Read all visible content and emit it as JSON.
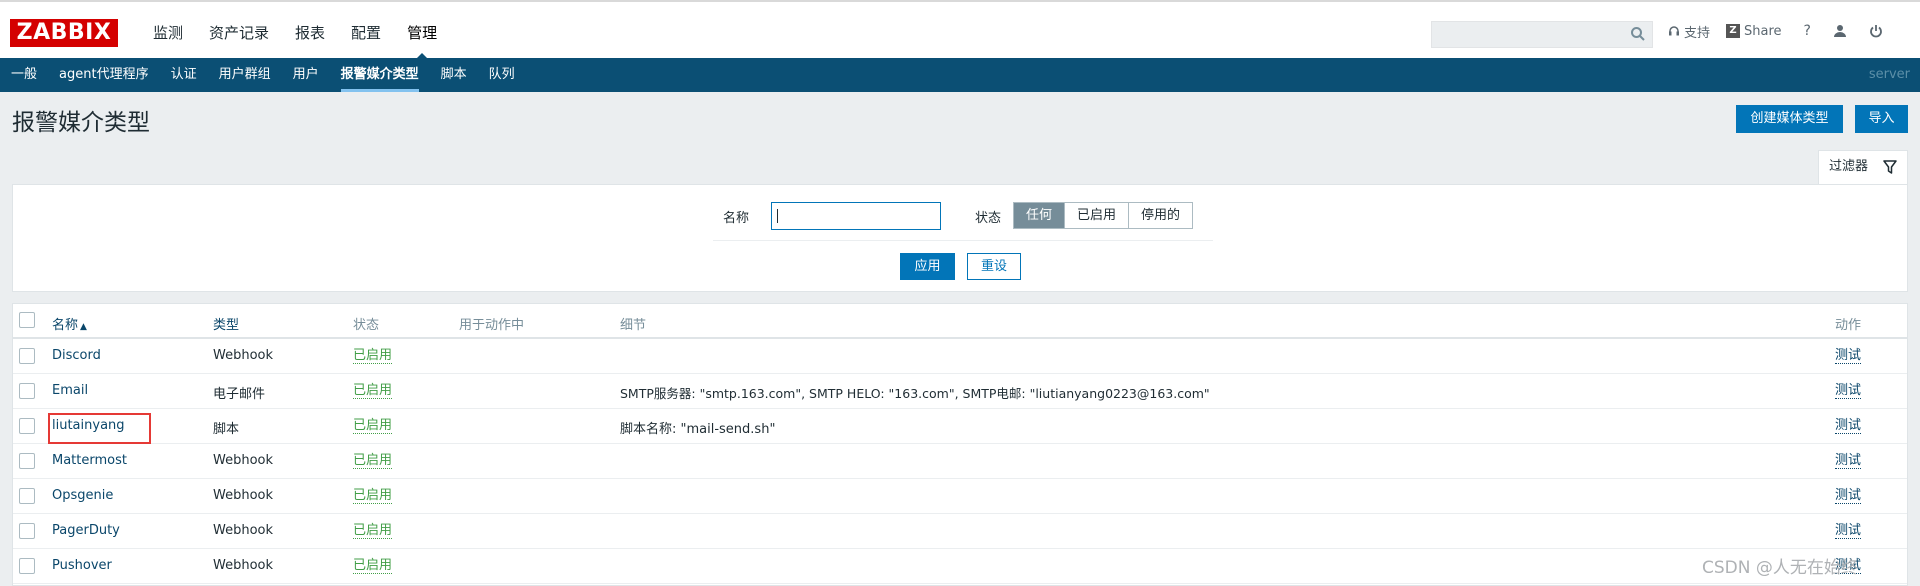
{
  "logo": "ZABBIX",
  "main_menu": [
    {
      "label": "监测"
    },
    {
      "label": "资产记录"
    },
    {
      "label": "报表"
    },
    {
      "label": "配置"
    },
    {
      "label": "管理",
      "active": true
    }
  ],
  "header_tools": {
    "search_value": "",
    "support_label": "支持",
    "share_label": "Share",
    "help_label": "?"
  },
  "sub_menu": [
    {
      "label": "一般"
    },
    {
      "label": "agent代理程序"
    },
    {
      "label": "认证"
    },
    {
      "label": "用户群组"
    },
    {
      "label": "用户"
    },
    {
      "label": "报警媒介类型",
      "active": true
    },
    {
      "label": "脚本"
    },
    {
      "label": "队列"
    }
  ],
  "server_name": "server",
  "page_title": "报警媒介类型",
  "actions": {
    "create_label": "创建媒体类型",
    "import_label": "导入"
  },
  "filter": {
    "tab_label": "过滤器",
    "name_label": "名称",
    "name_value": "",
    "status_label": "状态",
    "status_options": [
      "任何",
      "已启用",
      "停用的"
    ],
    "status_selected": "任何",
    "apply_label": "应用",
    "reset_label": "重设"
  },
  "table": {
    "columns": {
      "name": "名称",
      "sort_arrow": "▲",
      "type": "类型",
      "status": "状态",
      "used_in_actions": "用于动作中",
      "details": "细节",
      "action": "动作"
    },
    "rows": [
      {
        "name": "Discord",
        "type": "Webhook",
        "status": "已启用",
        "used": "",
        "details": "",
        "action": "测试"
      },
      {
        "name": "Email",
        "type": "电子邮件",
        "status": "已启用",
        "used": "",
        "details": "SMTP服务器: \"smtp.163.com\", SMTP HELO: \"163.com\", SMTP电邮: \"liutianyang0223@163.com\"",
        "action": "测试"
      },
      {
        "name": "liutainyang",
        "type": "脚本",
        "status": "已启用",
        "used": "",
        "details": "脚本名称: \"mail-send.sh\"",
        "action": "测试",
        "highlighted": true
      },
      {
        "name": "Mattermost",
        "type": "Webhook",
        "status": "已启用",
        "used": "",
        "details": "",
        "action": "测试"
      },
      {
        "name": "Opsgenie",
        "type": "Webhook",
        "status": "已启用",
        "used": "",
        "details": "",
        "action": "测试"
      },
      {
        "name": "PagerDuty",
        "type": "Webhook",
        "status": "已启用",
        "used": "",
        "details": "",
        "action": "测试"
      },
      {
        "name": "Pushover",
        "type": "Webhook",
        "status": "已启用",
        "used": "",
        "details": "",
        "action": "测试"
      }
    ]
  },
  "watermark": "CSDN @人无在始终",
  "colors": {
    "brand_red": "#d40000",
    "nav_blue": "#0b4f74",
    "primary_button": "#0275b8",
    "status_enabled": "#429e47",
    "link": "#0a466a",
    "highlight_box": "#e53935"
  }
}
